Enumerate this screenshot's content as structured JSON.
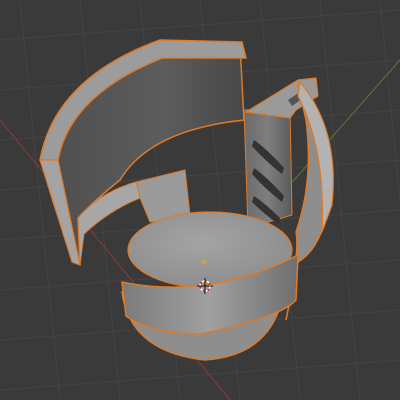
{
  "viewport": {
    "background_color": "#3a3a3a",
    "grid_color": "#444444",
    "x_axis_color": "#8a3a3a",
    "y_axis_color": "#5a7a3a",
    "selection_outline_color": "#e07a26"
  },
  "selected_object": {
    "description_icon": "3d-printed-cup-holder-mesh",
    "selected": true,
    "body_color": "#8d8d8d"
  },
  "origin_marker": {
    "icon": "object-origin-icon"
  },
  "cursor_3d": {
    "icon": "3d-cursor-icon"
  }
}
